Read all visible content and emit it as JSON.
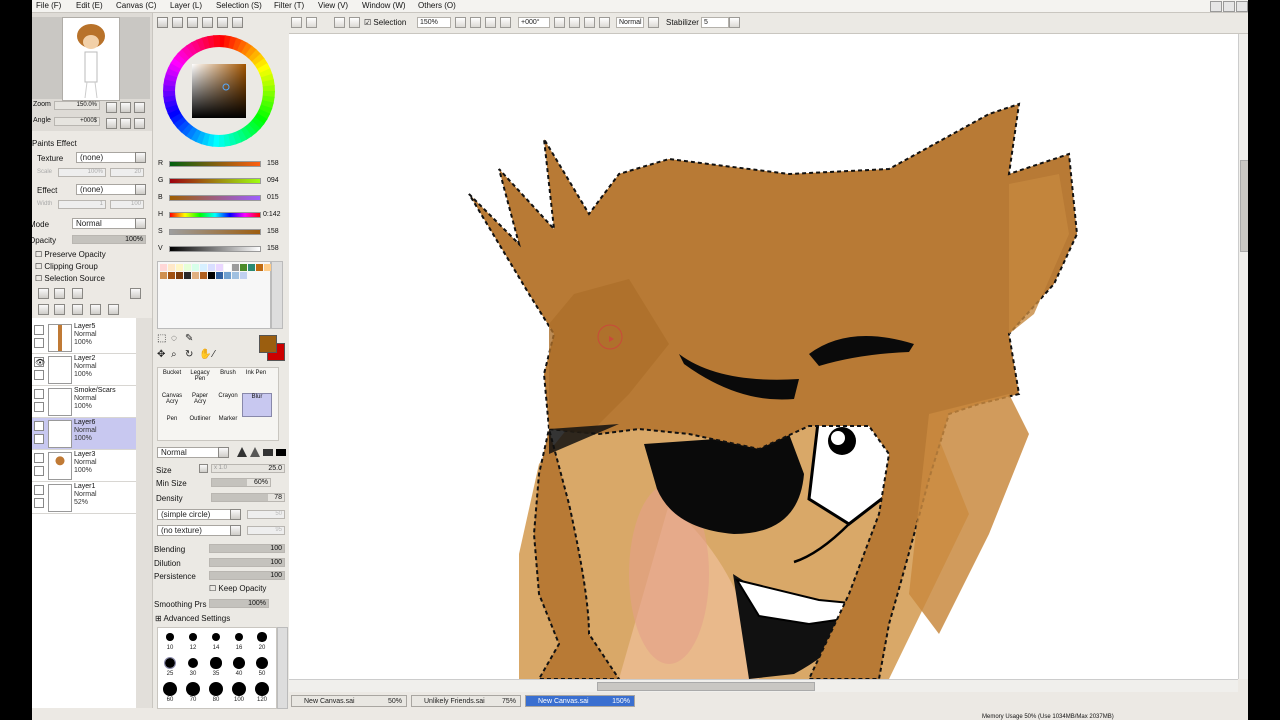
{
  "menu": [
    "File (F)",
    "Edit (E)",
    "Canvas (C)",
    "Layer (L)",
    "Selection (S)",
    "Filter (T)",
    "View (V)",
    "Window (W)",
    "Others (O)"
  ],
  "toolbar": {
    "selection_label": "Selection",
    "zoom": "150%",
    "angle": "+000°",
    "blend_mode": "Normal",
    "stabilizer_label": "Stabilizer",
    "stabilizer_value": "5"
  },
  "navigator": {
    "zoom_label": "Zoom",
    "zoom_value": "150.0%",
    "angle_label": "Angle",
    "angle_value": "+000$"
  },
  "paint_effect": {
    "header": "Paints Effect",
    "texture_label": "Texture",
    "texture_value": "(none)",
    "scale_label": "Scale",
    "scale_value": "100%",
    "scale_num": "20",
    "effect_label": "Effect",
    "effect_value": "(none)",
    "width_label": "Width",
    "width_num": "1",
    "width_max": "100"
  },
  "layer_props": {
    "mode_label": "Mode",
    "mode_value": "Normal",
    "opacity_label": "Opacity",
    "opacity_value": "100%",
    "preserve_opacity": "Preserve Opacity",
    "clipping_group": "Clipping Group",
    "selection_source": "Selection Source"
  },
  "layers": [
    {
      "name": "Layer5",
      "mode": "Normal",
      "opacity": "100%",
      "visible": false,
      "selected": false
    },
    {
      "name": "Layer2",
      "mode": "Normal",
      "opacity": "100%",
      "visible": true,
      "selected": false
    },
    {
      "name": "Smoke/Scars",
      "mode": "Normal",
      "opacity": "100%",
      "visible": true,
      "selected": false
    },
    {
      "name": "Layer6",
      "mode": "Normal",
      "opacity": "100%",
      "visible": true,
      "selected": true
    },
    {
      "name": "Layer3",
      "mode": "Normal",
      "opacity": "100%",
      "visible": true,
      "selected": false
    },
    {
      "name": "Layer1",
      "mode": "Normal",
      "opacity": "52%",
      "visible": false,
      "selected": false
    }
  ],
  "color": {
    "current": "#9b5e0f",
    "secondary": "#cc0000",
    "R": "158",
    "G": "094",
    "B": "015",
    "H": "0:142",
    "S": "158",
    "V": "158",
    "r_frac": 0.62,
    "g_frac": 0.37,
    "b_frac": 0.06,
    "h_frac": 0.4,
    "s_frac": 0.62,
    "v_frac": 0.62
  },
  "swatches": [
    "#ffd7d7",
    "#ffe8c8",
    "#fff6c6",
    "#e6ffd7",
    "#d7ffea",
    "#d7f0ff",
    "#d9deff",
    "#ead7ff",
    "#ffffff",
    "#9c9c9c",
    "#4b8a2a",
    "#2a8a73",
    "#c06a10",
    "#ffcc88",
    "#d09050",
    "#a05010",
    "#7a3a0a",
    "#2a2a2a",
    "#e0b080",
    "#b06020",
    "#000000",
    "#3060a0",
    "#70a0d0",
    "#a0c0e0",
    "#c0d0f0"
  ],
  "tools": {
    "row1": [
      "Bucket",
      "Legacy Pen",
      "Brush",
      "Ink Pen"
    ],
    "row2": [
      "Canvas Acry",
      "Paper Acry",
      "Crayon",
      "Blur"
    ],
    "row3": [
      "Pen",
      "Outliner",
      "Marker"
    ]
  },
  "brush": {
    "mode": "Normal",
    "size_label": "Size",
    "size_mult": "x 1.0",
    "size_value": "25.0",
    "min_size_label": "Min Size",
    "min_size_value": "60%",
    "density_label": "Density",
    "density_value": "78",
    "shape": "(simple circle)",
    "shape_num": "50",
    "texture": "(no texture)",
    "texture_num": "95",
    "blending_label": "Blending",
    "blending_value": "100",
    "dilution_label": "Dilution",
    "dilution_value": "100",
    "persistence_label": "Persistence",
    "persistence_value": "100",
    "keep_opacity": "Keep Opacity",
    "smoothing_label": "Smoothing Prs",
    "smoothing_value": "100%",
    "advanced": "Advanced Settings",
    "sizes_row1": [
      "10",
      "12",
      "14",
      "16",
      "20"
    ],
    "sizes_row2": [
      "25",
      "30",
      "35",
      "40",
      "50"
    ],
    "sizes_row3": [
      "60",
      "70",
      "80",
      "100",
      "120"
    ]
  },
  "documents": [
    {
      "name": "New Canvas.sai",
      "zoom": "50%",
      "active": false
    },
    {
      "name": "Unlikely Friends.sai",
      "zoom": "75%",
      "active": false
    },
    {
      "name": "New Canvas.sai",
      "zoom": "150%",
      "active": true
    }
  ],
  "status": {
    "memory": "Memory Usage 50% (Use 1034MB/Max 2037MB)"
  }
}
